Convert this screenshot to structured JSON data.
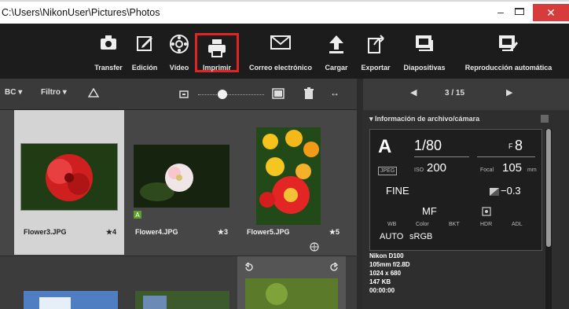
{
  "window": {
    "title": "C:\\Users\\NikonUser\\Pictures\\Photos",
    "min": "–",
    "close": "✕"
  },
  "toolbar": {
    "items": [
      {
        "label": "Transfer",
        "icon": "camera-icon"
      },
      {
        "label": "Edición",
        "icon": "edit-icon"
      },
      {
        "label": "Vídeo",
        "icon": "video-icon"
      },
      {
        "label": "Imprimir",
        "icon": "printer-icon",
        "highlight_color": "#e02424"
      },
      {
        "label": "Correo electrónico",
        "icon": "mail-icon"
      },
      {
        "label": "Cargar",
        "icon": "upload-icon"
      },
      {
        "label": "Exportar",
        "icon": "export-icon"
      },
      {
        "label": "Diapositivas",
        "icon": "slideshow-icon"
      },
      {
        "label": "Reproducción automática",
        "icon": "autoplay-icon"
      }
    ]
  },
  "filterbar": {
    "sort": "BC ▾",
    "filter": "Filtro ▾",
    "fit": "↔"
  },
  "grid": {
    "items": [
      {
        "file": "Flower3.JPG",
        "rating": "★4"
      },
      {
        "file": "Flower4.JPG",
        "rating": "★3"
      },
      {
        "file": "Flower5.JPG",
        "rating": "★5"
      }
    ]
  },
  "panel": {
    "page": "3 / 15",
    "section": "Información de archivo/cámara",
    "mode": "A",
    "shutter": "1/80",
    "aperture_prefix": "F",
    "aperture": "8",
    "format": "JPEG",
    "iso_label": "ISO",
    "iso": "200",
    "focal_label": "Focal",
    "focal": "105",
    "focal_unit": "mm",
    "quality": "FINE",
    "exposure_comp": "−0.3",
    "focus": "MF",
    "labels": [
      "WB",
      "Color",
      "BKT",
      "HDR",
      "ADL"
    ],
    "wb": "AUTO",
    "color": "sRGB",
    "camera": "Nikon D100",
    "lens": "105mm f/2.8D",
    "size": "1024 x 680",
    "filesize": "147 KB",
    "time": "00:00:00"
  }
}
